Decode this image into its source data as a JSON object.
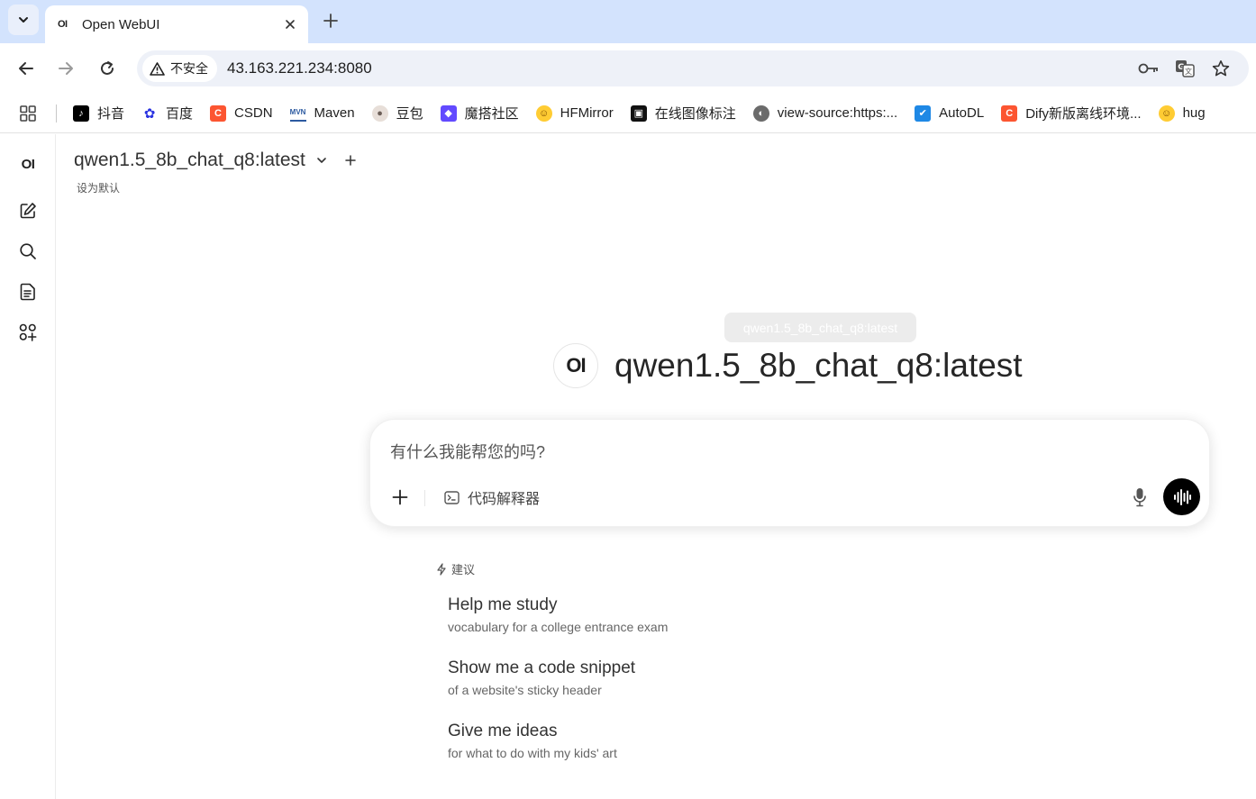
{
  "browser": {
    "tab_title": "Open WebUI",
    "tab_favicon": "OI",
    "security_label": "不安全",
    "url": "43.163.221.234:8080",
    "icons": [
      "tab-search-icon",
      "close-icon",
      "plus-icon",
      "back-icon",
      "forward-icon",
      "reload-icon",
      "warning-icon",
      "key-icon",
      "translate-icon",
      "star-icon",
      "apps-grid-icon"
    ]
  },
  "bookmarks": [
    {
      "label": "抖音",
      "color": "#000000",
      "glyph": "♪"
    },
    {
      "label": "百度",
      "color": "#2932e1",
      "glyph": "✿"
    },
    {
      "label": "CSDN",
      "color": "#fc5531",
      "glyph": "C"
    },
    {
      "label": "Maven",
      "color": "#2c5aa0",
      "glyph": "M"
    },
    {
      "label": "豆包",
      "color": "#6b5e57",
      "glyph": "●"
    },
    {
      "label": "魔搭社区",
      "color": "#624aff",
      "glyph": "◆"
    },
    {
      "label": "HFMirror",
      "color": "#ffcc33",
      "glyph": "☺"
    },
    {
      "label": "在线图像标注",
      "color": "#111111",
      "glyph": "▣"
    },
    {
      "label": "view-source:https:...",
      "color": "#6b6b6b",
      "glyph": "◐"
    },
    {
      "label": "AutoDL",
      "color": "#1e88e5",
      "glyph": "✔"
    },
    {
      "label": "Dify新版离线环境...",
      "color": "#fc5531",
      "glyph": "C"
    },
    {
      "label": "hug",
      "color": "#ffcc33",
      "glyph": "☺"
    }
  ],
  "sidebar": {
    "logo": "OI",
    "icons": [
      "new-chat-icon",
      "search-icon",
      "notes-icon",
      "workspace-icon"
    ]
  },
  "main": {
    "model_name": "qwen1.5_8b_chat_q8:latest",
    "add_model": "+",
    "set_default": "设为默认",
    "tooltip": "qwen1.5_8b_chat_q8:latest",
    "hero_logo": "OI",
    "hero_title": "qwen1.5_8b_chat_q8:latest"
  },
  "composer": {
    "placeholder": "有什么我能帮您的吗?",
    "attach": "+",
    "code_interpreter": "代码解释器"
  },
  "suggestions": {
    "heading": "建议",
    "items": [
      {
        "title": "Help me study",
        "subtitle": "vocabulary for a college entrance exam"
      },
      {
        "title": "Show me a code snippet",
        "subtitle": "of a website's sticky header"
      },
      {
        "title": "Give me ideas",
        "subtitle": "for what to do with my kids' art"
      }
    ]
  }
}
